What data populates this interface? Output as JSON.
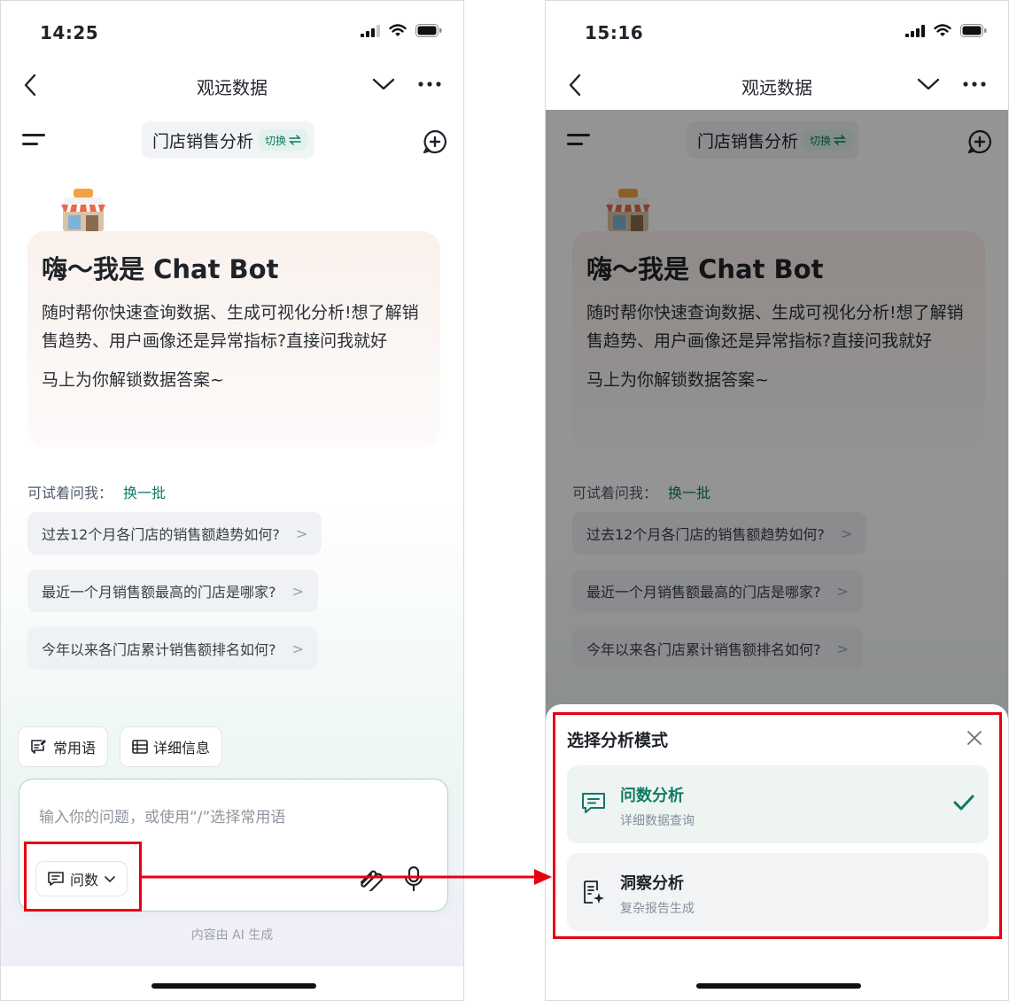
{
  "colors": {
    "accent": "#0e7a64",
    "annotation_red": "#e60012"
  },
  "left_phone": {
    "status_time": "14:25",
    "header": {
      "title": "观远数据"
    },
    "agent": {
      "name": "门店销售分析",
      "switch_label": "切换"
    },
    "welcome": {
      "title": "嗨～我是 Chat Bot",
      "body": "随时帮你快速查询数据、生成可视化分析!想了解销售趋势、用户画像还是异常指标?直接问我就好",
      "sub": "马上为你解锁数据答案~"
    },
    "try_label": "可试着问我：",
    "refresh_label": "换一批",
    "suggestions": [
      "过去12个月各门店的销售额趋势如何?",
      "最近一个月销售额最高的门店是哪家?",
      "今年以来各门店累计销售额排名如何?"
    ],
    "chips": {
      "phrases": "常用语",
      "details": "详细信息"
    },
    "input": {
      "placeholder": "输入你的问题，或使用“/”选择常用语",
      "mode_label": "问数"
    },
    "ai_note": "内容由 AI 生成"
  },
  "right_phone": {
    "status_time": "15:16",
    "header": {
      "title": "观远数据"
    },
    "agent": {
      "name": "门店销售分析",
      "switch_label": "切换"
    },
    "welcome": {
      "title": "嗨～我是 Chat Bot",
      "body": "随时帮你快速查询数据、生成可视化分析!想了解销售趋势、用户画像还是异常指标?直接问我就好",
      "sub": "马上为你解锁数据答案~"
    },
    "try_label": "可试着问我：",
    "refresh_label": "换一批",
    "suggestions": [
      "过去12个月各门店的销售额趋势如何?",
      "最近一个月销售额最高的门店是哪家?",
      "今年以来各门店累计销售额排名如何?"
    ],
    "sheet": {
      "title": "选择分析模式",
      "options": [
        {
          "title": "问数分析",
          "desc": "详细数据查询",
          "selected": true
        },
        {
          "title": "洞察分析",
          "desc": "复杂报告生成",
          "selected": false
        }
      ]
    }
  }
}
